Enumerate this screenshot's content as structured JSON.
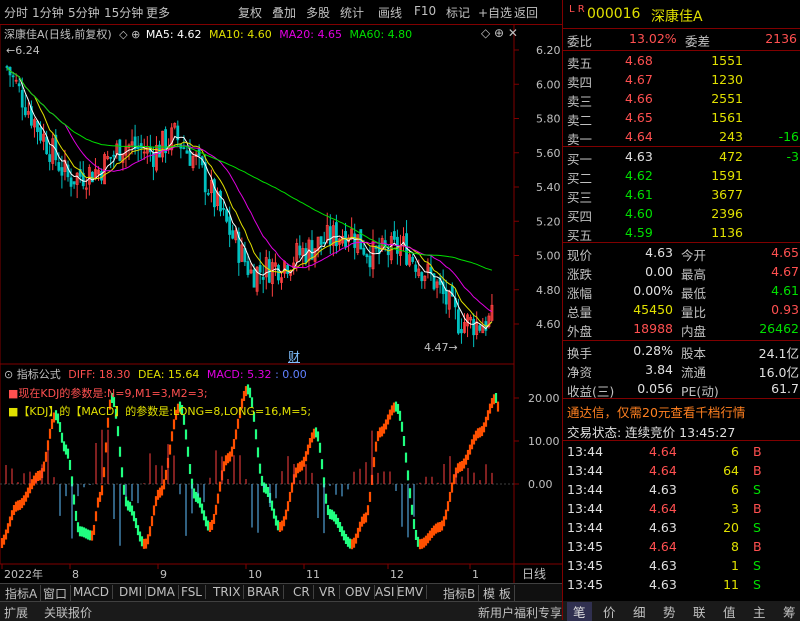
{
  "toolbar": {
    "items": [
      "分时",
      "1分钟",
      "5分钟",
      "15分钟",
      "更多",
      "复权",
      "叠加",
      "多股",
      "统计",
      "画线",
      "F10",
      "标记",
      "+自选",
      "返回"
    ]
  },
  "chart": {
    "stock_title": "深康佳A",
    "adjust_note": "(日线,前复权)",
    "ma5_label": "MA5: 4.62",
    "ma10_label": "MA10: 4.60",
    "ma20_label": "MA20: 4.65",
    "ma60_label": "MA60: 4.80",
    "high_marker": "6.24",
    "low_marker": "4.47",
    "fin_marker": "财",
    "price_axis": [
      "6.20",
      "6.00",
      "5.80",
      "5.60",
      "5.40",
      "5.20",
      "5.00",
      "4.80",
      "4.60"
    ],
    "indicator_btn": "指标公式",
    "diff_label": "DIFF: 18.30",
    "dea_label": "DEA: 15.64",
    "macd_label": "MACD: 5.32",
    "macd_extra": ": 0.00",
    "note1": "■现在KDJ的参数是:N=9,M1=3,M2=3;",
    "note2": "■【KDJ】的【MACD】的参数是:LONG=8,LONG=16,M=5;",
    "ind_axis": [
      "20.00",
      "10.00",
      "0.00"
    ],
    "date_labels": [
      "2022年",
      "8",
      "9",
      "10",
      "11",
      "12",
      "1"
    ],
    "date_suffix": "日线",
    "colors": {
      "ma5": "#ffffff",
      "ma10": "#e0e000",
      "ma20": "#e000e0",
      "ma60": "#00e000",
      "up": "#ff4040",
      "down": "#00c0c0",
      "macd_pos": "#ff5000",
      "macd_neg": "#20ff80"
    }
  },
  "tabs": [
    "指标A",
    "窗口",
    "MACD",
    "DMI",
    "DMA",
    "FSL",
    "TRIX",
    "BRAR",
    "CR",
    "VR",
    "OBV",
    "ASI",
    "EMV",
    "指标B",
    "模 板"
  ],
  "status": {
    "left": [
      "扩展",
      "关联报价"
    ],
    "promo": "新用户福利专享",
    "right_tabs": [
      "笔",
      "价",
      "细",
      "势",
      "联",
      "值",
      "主",
      "筹"
    ]
  },
  "quote": {
    "code": "000016",
    "name": "深康佳A",
    "weibi_label": "委比",
    "weibi": "13.02%",
    "weicha_label": "委差",
    "weicha": "2136",
    "asks": [
      {
        "label": "卖五",
        "price": "4.68",
        "vol": "1551",
        "chg": ""
      },
      {
        "label": "卖四",
        "price": "4.67",
        "vol": "1230",
        "chg": ""
      },
      {
        "label": "卖三",
        "price": "4.66",
        "vol": "2551",
        "chg": ""
      },
      {
        "label": "卖二",
        "price": "4.65",
        "vol": "1561",
        "chg": ""
      },
      {
        "label": "卖一",
        "price": "4.64",
        "vol": "243",
        "chg": "-16"
      }
    ],
    "bids": [
      {
        "label": "买一",
        "price": "4.63",
        "vol": "472",
        "chg": "-3"
      },
      {
        "label": "买二",
        "price": "4.62",
        "vol": "1591",
        "chg": ""
      },
      {
        "label": "买三",
        "price": "4.61",
        "vol": "3677",
        "chg": ""
      },
      {
        "label": "买四",
        "price": "4.60",
        "vol": "2396",
        "chg": ""
      },
      {
        "label": "买五",
        "price": "4.59",
        "vol": "1136",
        "chg": ""
      }
    ],
    "stats": [
      {
        "l1": "现价",
        "v1": "4.63",
        "l2": "今开",
        "v2": "4.65"
      },
      {
        "l1": "涨跌",
        "v1": "0.00",
        "l2": "最高",
        "v2": "4.67"
      },
      {
        "l1": "涨幅",
        "v1": "0.00%",
        "l2": "最低",
        "v2": "4.61"
      },
      {
        "l1": "总量",
        "v1": "45450",
        "l2": "量比",
        "v2": "0.93"
      },
      {
        "l1": "外盘",
        "v1": "18988",
        "l2": "内盘",
        "v2": "26462"
      }
    ],
    "stats2": [
      {
        "l1": "换手",
        "v1": "0.28%",
        "l2": "股本",
        "v2": "24.1亿"
      },
      {
        "l1": "净资",
        "v1": "3.84",
        "l2": "流通",
        "v2": "16.0亿"
      },
      {
        "l1": "收益(三)",
        "v1": "0.056",
        "l2": "PE(动)",
        "v2": "61.7"
      }
    ],
    "promo": "通达信，仅需20元查看千档行情",
    "trade_state": "交易状态: 连续竞价 13:45:27",
    "ticks": [
      {
        "t": "13:44",
        "p": "4.64",
        "v": "6",
        "s": "B"
      },
      {
        "t": "13:44",
        "p": "4.64",
        "v": "64",
        "s": "B"
      },
      {
        "t": "13:44",
        "p": "4.63",
        "v": "6",
        "s": "S"
      },
      {
        "t": "13:44",
        "p": "4.64",
        "v": "3",
        "s": "B"
      },
      {
        "t": "13:44",
        "p": "4.63",
        "v": "20",
        "s": "S"
      },
      {
        "t": "13:45",
        "p": "4.64",
        "v": "8",
        "s": "B"
      },
      {
        "t": "13:45",
        "p": "4.63",
        "v": "1",
        "s": "S"
      },
      {
        "t": "13:45",
        "p": "4.63",
        "v": "11",
        "s": "S"
      }
    ]
  }
}
